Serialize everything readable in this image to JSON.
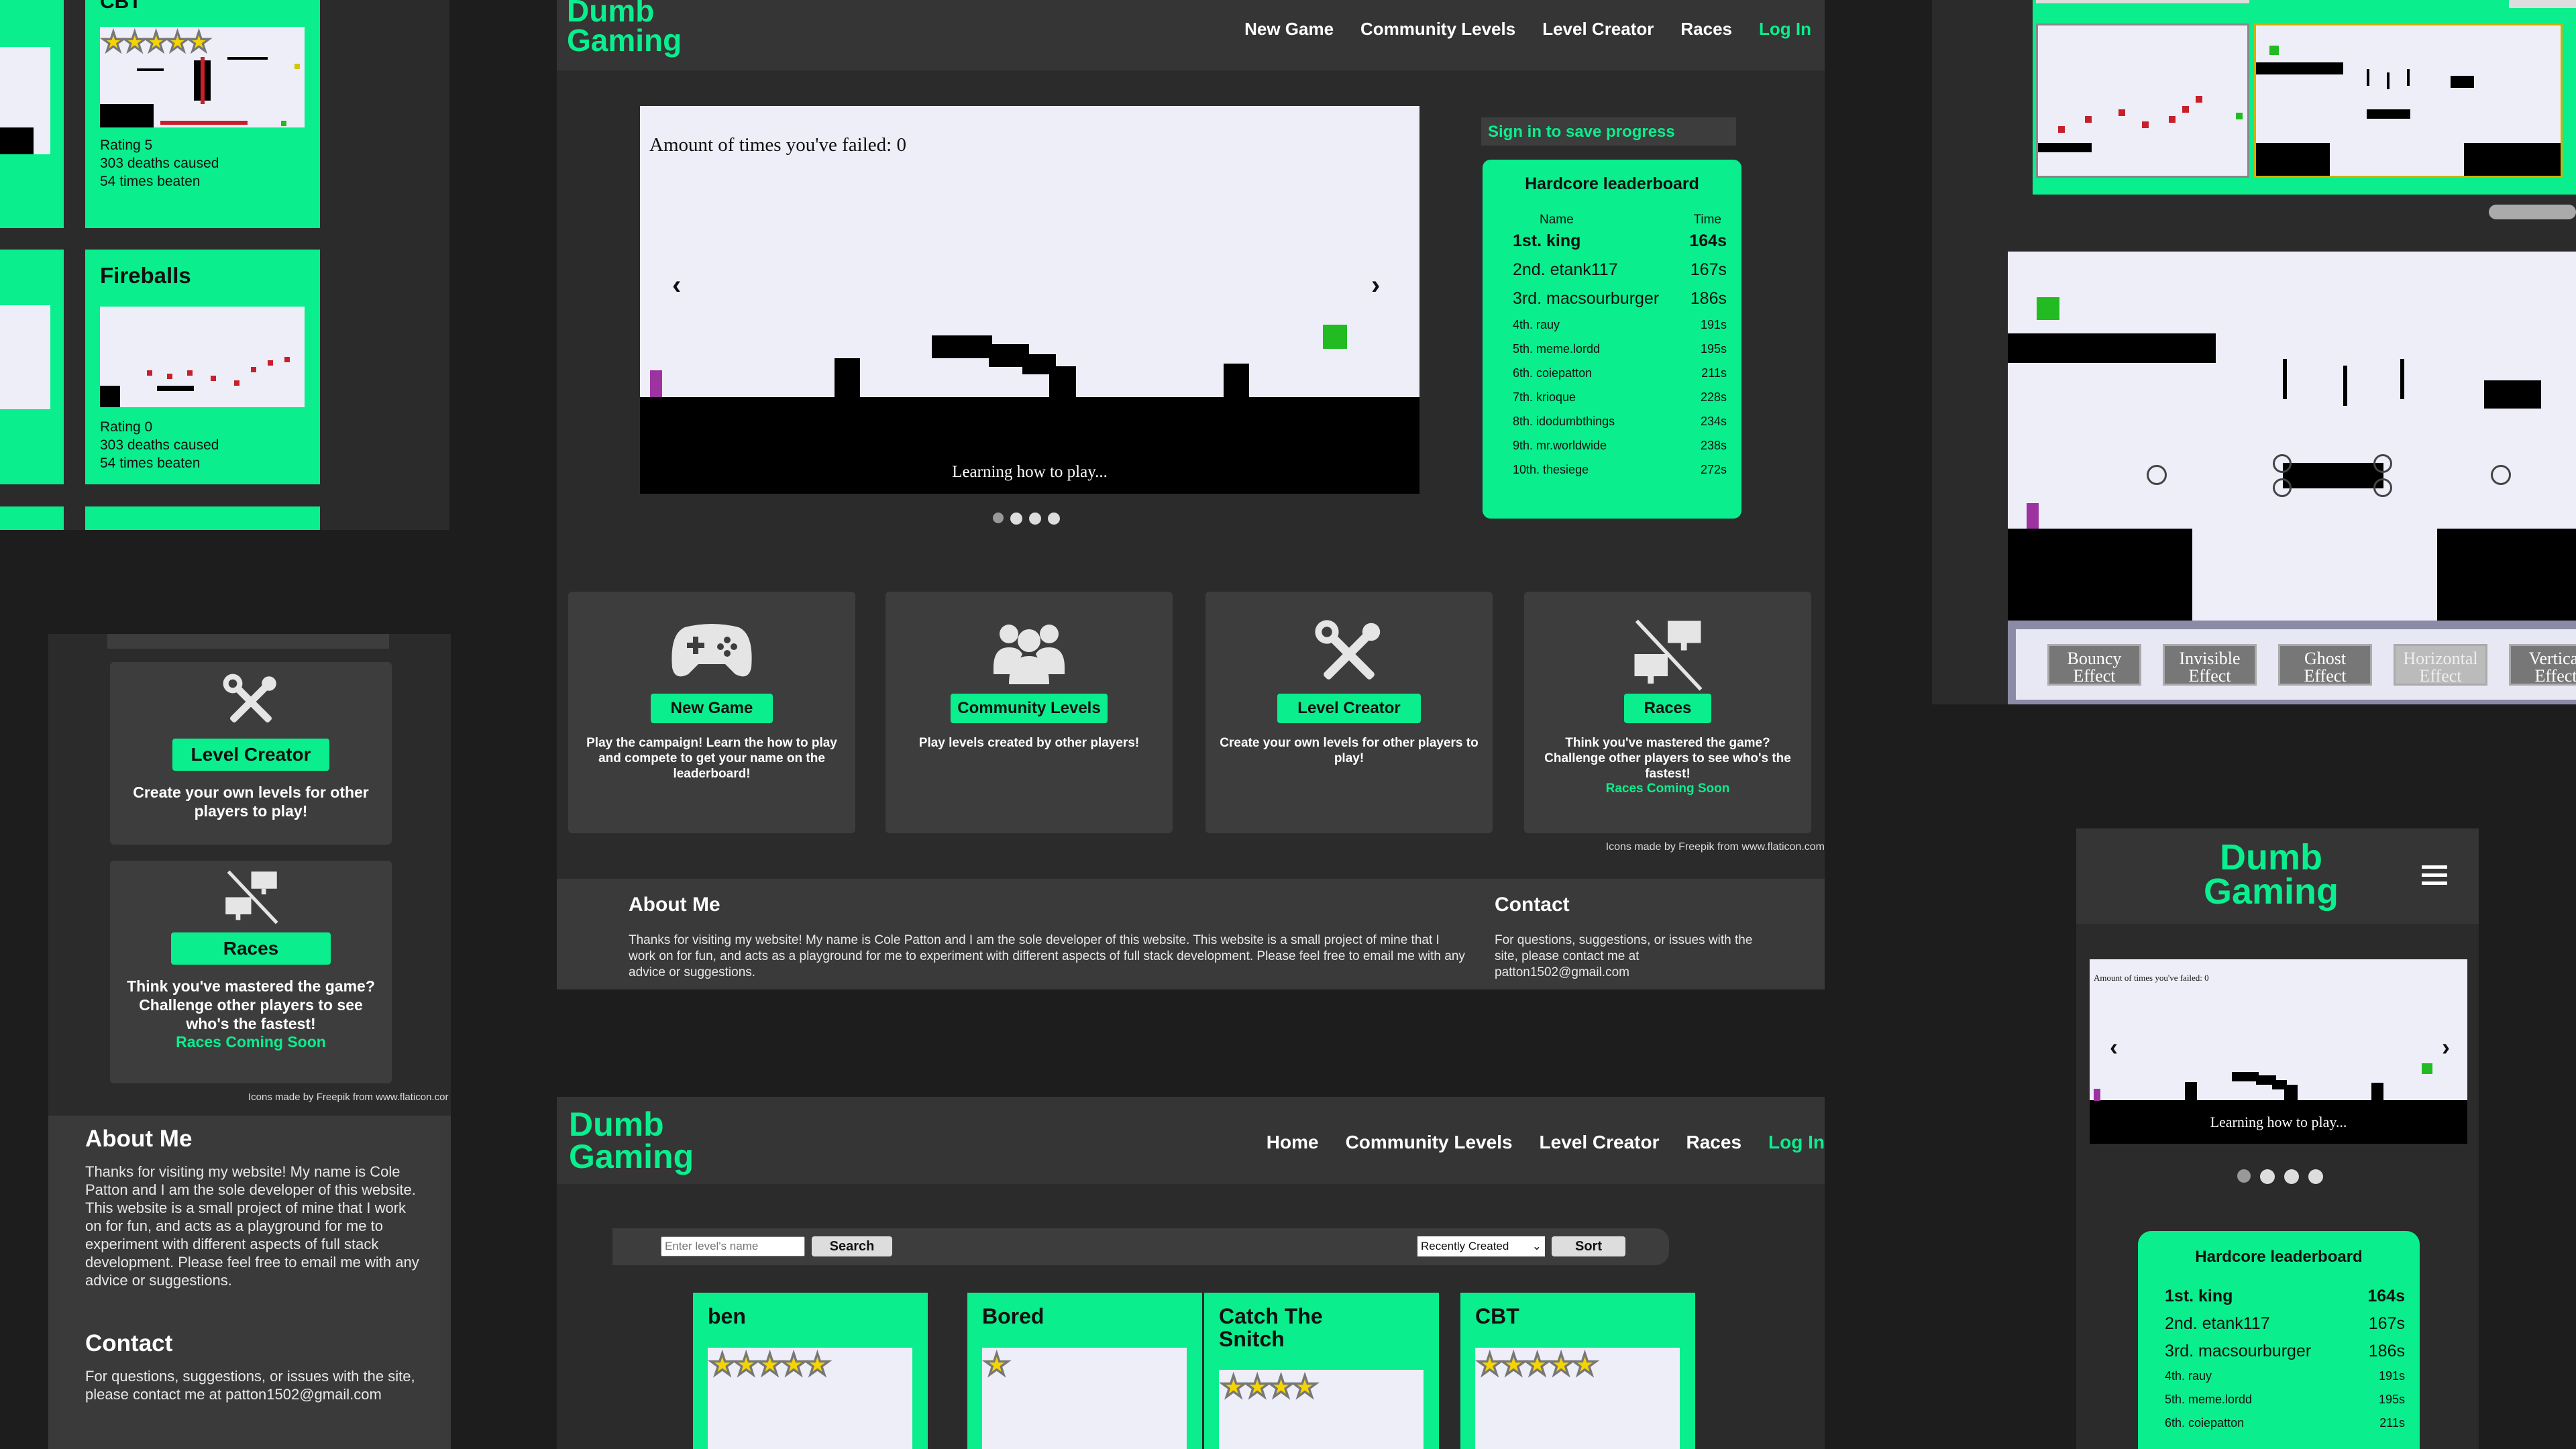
{
  "brand": {
    "logo_line1": "Dumb",
    "logo_line2": "Gaming"
  },
  "nav_main": {
    "items": [
      "New Game",
      "Community Levels",
      "Level Creator",
      "Races"
    ],
    "login": "Log In"
  },
  "nav_community": {
    "items": [
      "Home",
      "Community Levels",
      "Level Creator",
      "Races"
    ],
    "login": "Log In"
  },
  "game": {
    "fail_text": "Amount of times you've failed: 0",
    "caption": "Learning how to play...",
    "prev": "‹",
    "next": "›"
  },
  "sign_in": "Sign in to save progress",
  "leaderboard": {
    "title": "Hardcore leaderboard",
    "col_name": "Name",
    "col_time": "Time",
    "rows": [
      {
        "name": "1st. king",
        "time": "164s"
      },
      {
        "name": "2nd. etank117",
        "time": "167s"
      },
      {
        "name": "3rd. macsourburger",
        "time": "186s"
      },
      {
        "name": "4th. rauy",
        "time": "191s"
      },
      {
        "name": "5th. meme.lordd",
        "time": "195s"
      },
      {
        "name": "6th. coiepatton",
        "time": "211s"
      },
      {
        "name": "7th. krioque",
        "time": "228s"
      },
      {
        "name": "8th. idodumbthings",
        "time": "234s"
      },
      {
        "name": "9th. mr.worldwide",
        "time": "238s"
      },
      {
        "name": "10th. thesiege",
        "time": "272s"
      }
    ]
  },
  "cards": [
    {
      "button": "New Game",
      "desc": "Play the campaign! Learn the how to play and compete to get your name on the leaderboard!",
      "extra": "",
      "icon": "gamepad-icon"
    },
    {
      "button": "Community Levels",
      "desc": "Play levels created by other players!",
      "extra": "",
      "icon": "users-icon"
    },
    {
      "button": "Level Creator",
      "desc": "Create your own levels for other players to play!",
      "extra": "",
      "icon": "tools-icon"
    },
    {
      "button": "Races",
      "desc": "Think you've mastered the game? Challenge other players to see who's the fastest!",
      "extra": "Races Coming Soon",
      "icon": "no-monitors-icon"
    }
  ],
  "credit": "Icons made by Freepik from www.flaticon.com",
  "credit_cut": "Icons made by Freepik from www.flaticon.cor",
  "about": {
    "title": "About Me",
    "text": "Thanks for visiting my website! My name is Cole Patton and I am the sole developer of this website. This website is a small project of mine that I work on for fun, and acts as a playground for me to experiment with different aspects of full stack development. Please feel free to email me with any advice or suggestions."
  },
  "contact": {
    "title": "Contact",
    "text": "For questions, suggestions, or issues with the site, please contact me at patton1502@gmail.com"
  },
  "search": {
    "placeholder": "Enter level's name",
    "search_btn": "Search",
    "sort_value": "Recently Created",
    "sort_btn": "Sort"
  },
  "levels": [
    {
      "title": "ben",
      "stars": 5
    },
    {
      "title": "Bored",
      "stars": 1
    },
    {
      "title": "Catch The Snitch",
      "stars": 4
    },
    {
      "title": "CBT",
      "stars": 5
    }
  ],
  "side_levels": [
    {
      "title": "CBT",
      "rating": "Rating 5",
      "deaths": "303 deaths caused",
      "beaten": "54 times beaten"
    },
    {
      "title": "Fireballs",
      "rating": "Rating 0",
      "deaths": "303 deaths caused",
      "beaten": "54 times beaten"
    }
  ],
  "effects": [
    "Bouncy Effect",
    "Invisible Effect",
    "Ghost Effect",
    "Horizontal Effect",
    "Vertical Effect"
  ],
  "mobile": {
    "fail_text": "Amount of times you've failed: 0",
    "caption": "Learning how to play..."
  }
}
